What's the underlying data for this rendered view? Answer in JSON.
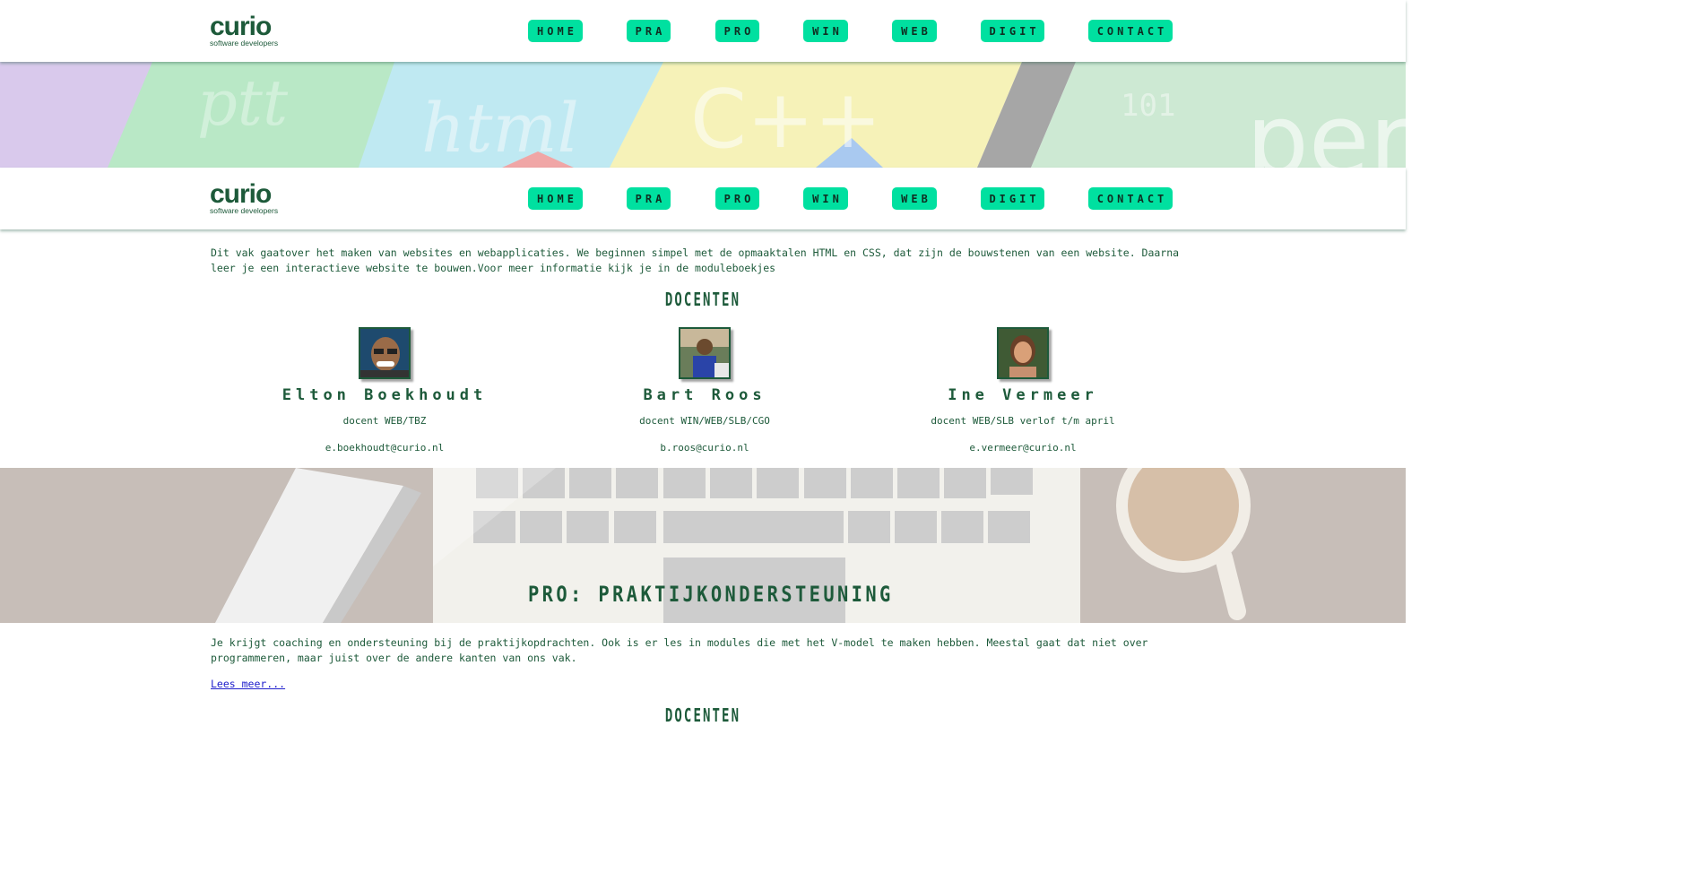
{
  "logo": {
    "main": "curio",
    "sub": "software developers"
  },
  "nav": [
    "HOME",
    "PRA",
    "PRO",
    "WIN",
    "WEB",
    "DIGIT",
    "CONTACT"
  ],
  "web": {
    "intro": "Dit vak gaatover het maken van websites en webapplicaties. We beginnen simpel met de opmaaktalen HTML en CSS, dat zijn de bouwstenen van een website. Daarna leer je een interactieve website te bouwen.Voor meer informatie kijk je in de moduleboekjes",
    "docenten_heading": "DOCENTEN",
    "teachers": [
      {
        "name": "Elton Boekhoudt",
        "role": "docent WEB/TBZ",
        "email": "e.boekhoudt@curio.nl"
      },
      {
        "name": "Bart Roos",
        "role": "docent WIN/WEB/SLB/CGO",
        "email": "b.roos@curio.nl"
      },
      {
        "name": "Ine Vermeer",
        "role": "docent WEB/SLB verlof t/m april",
        "email": "e.vermeer@curio.nl"
      }
    ]
  },
  "pro": {
    "title": "PRO: PRAKTIJKONDERSTEUNING",
    "intro": "Je krijgt coaching en ondersteuning bij de praktijkopdrachten. Ook is er les in modules die met het V-model te maken hebben. Meestal gaat dat niet over programmeren, maar juist over de andere kanten van ons vak.",
    "lees_meer": "Lees meer...",
    "docenten_heading": "DOCENTEN"
  },
  "banner_texts": [
    "ptt",
    "html",
    "C++",
    "101",
    "perl"
  ],
  "colors": {
    "accent": "#00e0a0",
    "brand": "#1d5a3a",
    "link": "#2020cc"
  }
}
